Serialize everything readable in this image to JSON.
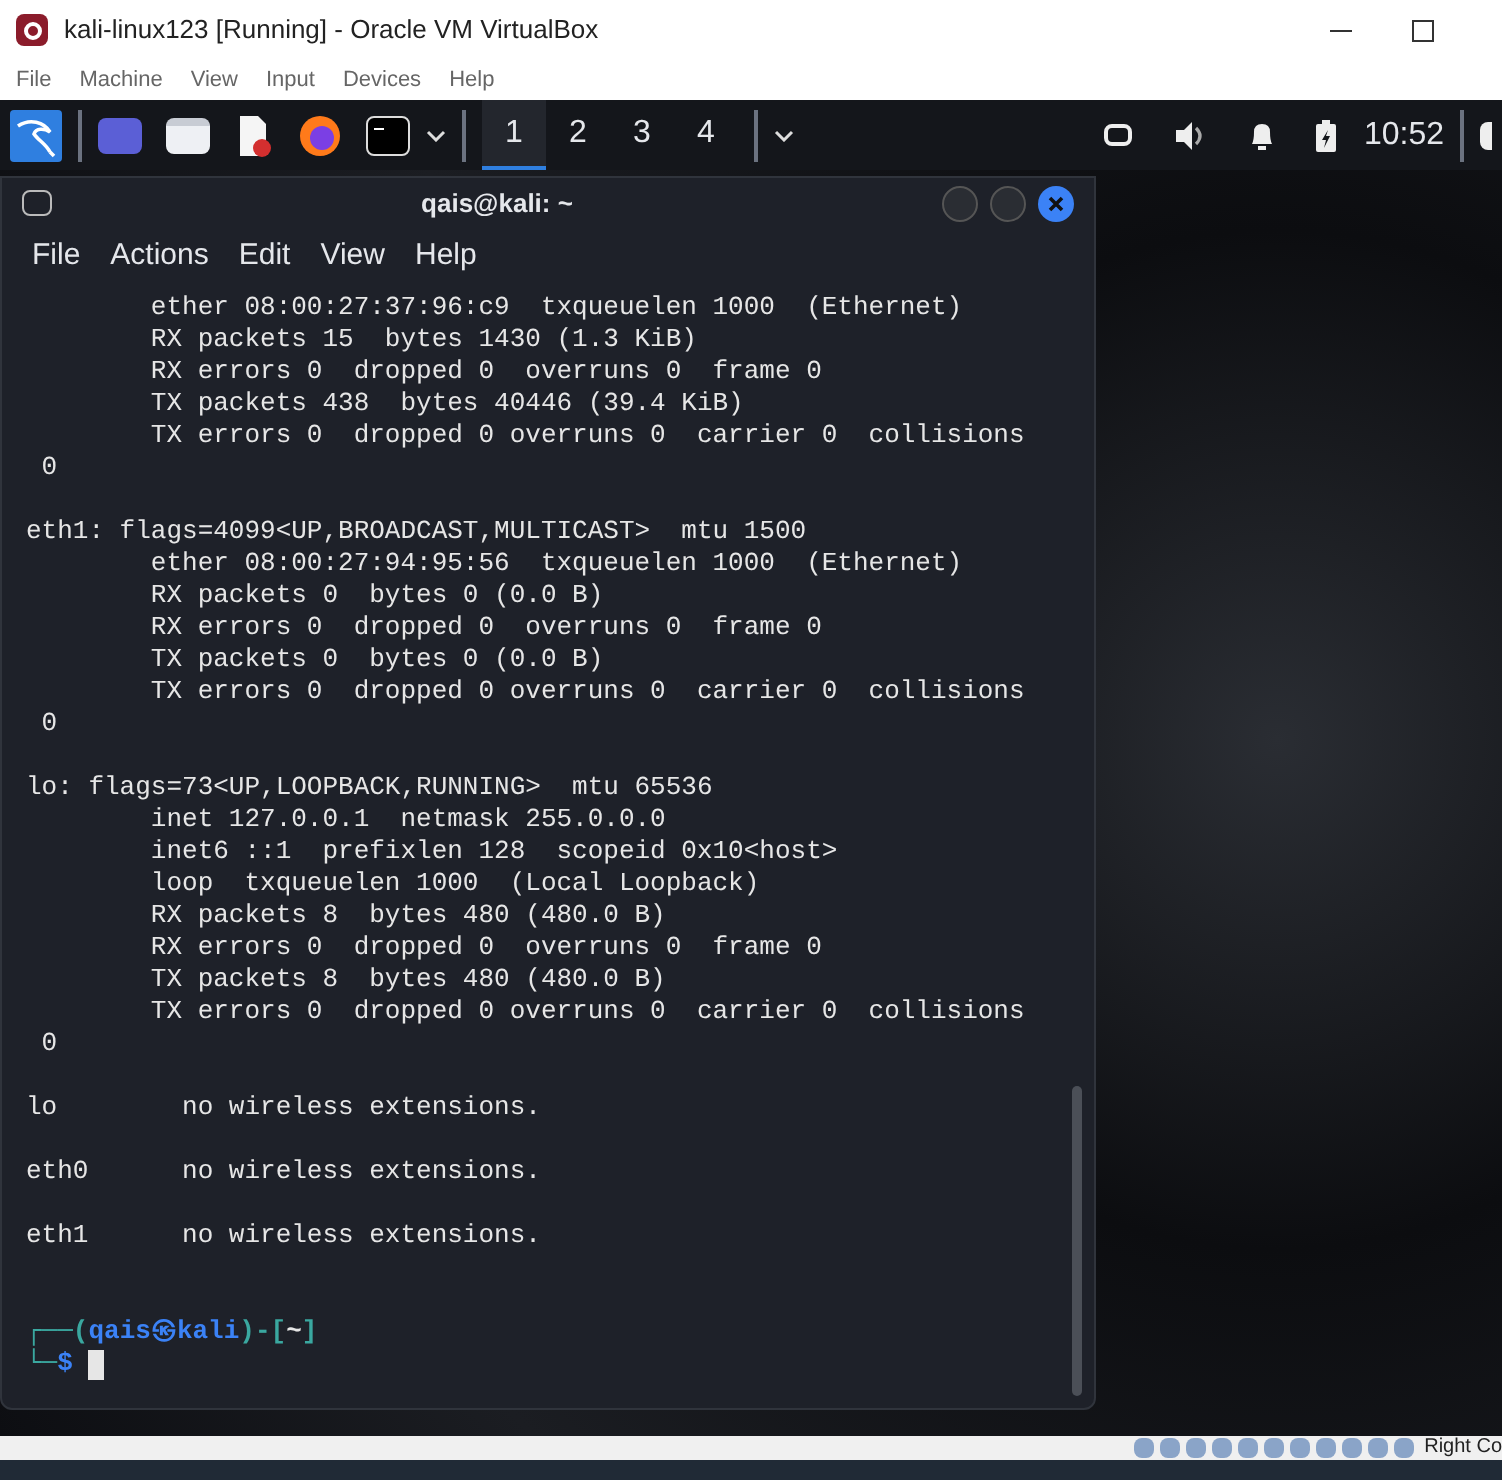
{
  "window": {
    "title": "kali-linux123 [Running] - Oracle VM VirtualBox"
  },
  "menu": [
    "File",
    "Machine",
    "View",
    "Input",
    "Devices",
    "Help"
  ],
  "panel": {
    "workspaces": [
      {
        "label": "1",
        "selected": true
      },
      {
        "label": "2",
        "selected": false
      },
      {
        "label": "3",
        "selected": false
      },
      {
        "label": "4",
        "selected": false
      }
    ],
    "clock": "10:52"
  },
  "terminal": {
    "title": "qais@kali: ~",
    "menu": [
      "File",
      "Actions",
      "Edit",
      "View",
      "Help"
    ],
    "blocks": [
      [
        "        ether 08:00:27:37:96:c9  txqueuelen 1000  (Ethernet)",
        "        RX packets 15  bytes 1430 (1.3 KiB)",
        "        RX errors 0  dropped 0  overruns 0  frame 0",
        "        TX packets 438  bytes 40446 (39.4 KiB)",
        "        TX errors 0  dropped 0 overruns 0  carrier 0  collisions",
        " 0"
      ],
      [
        "eth1: flags=4099<UP,BROADCAST,MULTICAST>  mtu 1500",
        "        ether 08:00:27:94:95:56  txqueuelen 1000  (Ethernet)",
        "        RX packets 0  bytes 0 (0.0 B)",
        "        RX errors 0  dropped 0  overruns 0  frame 0",
        "        TX packets 0  bytes 0 (0.0 B)",
        "        TX errors 0  dropped 0 overruns 0  carrier 0  collisions",
        " 0"
      ],
      [
        "lo: flags=73<UP,LOOPBACK,RUNNING>  mtu 65536",
        "        inet 127.0.0.1  netmask 255.0.0.0",
        "        inet6 ::1  prefixlen 128  scopeid 0x10<host>",
        "        loop  txqueuelen 1000  (Local Loopback)",
        "        RX packets 8  bytes 480 (480.0 B)",
        "        RX errors 0  dropped 0  overruns 0  frame 0",
        "        TX packets 8  bytes 480 (480.0 B)",
        "        TX errors 0  dropped 0 overruns 0  carrier 0  collisions",
        " 0"
      ],
      [
        "lo        no wireless extensions."
      ],
      [
        "eth0      no wireless extensions."
      ],
      [
        "eth1      no wireless extensions."
      ]
    ],
    "prompt": {
      "open": "┌──(",
      "user": "qais",
      "at": "㉿",
      "host": "kali",
      "mid": ")-[",
      "dir": "~",
      "close": "]",
      "corner": "└─",
      "symbol": "$"
    }
  },
  "status_bar": {
    "hint": "Right Co"
  }
}
